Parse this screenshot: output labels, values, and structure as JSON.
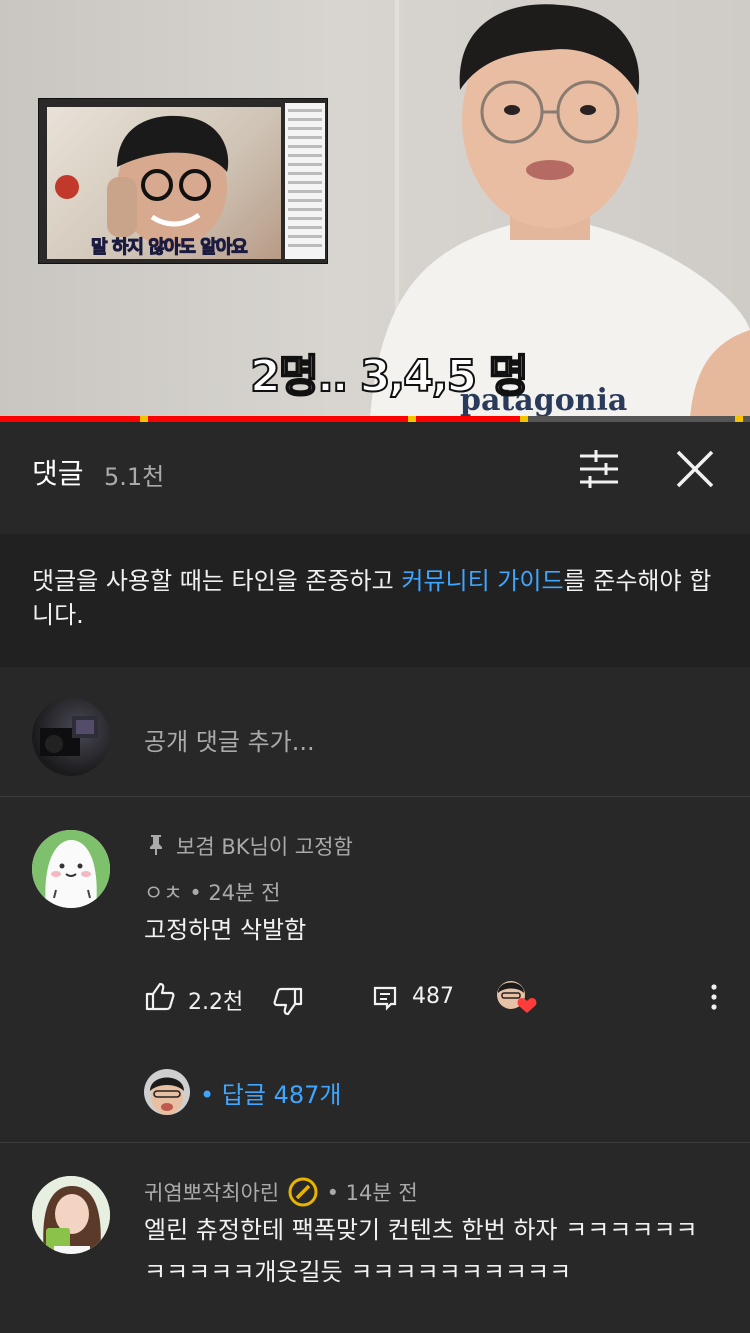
{
  "video": {
    "inset_caption_highlight": "말 하지",
    "inset_caption_rest": " 않아도 알아요",
    "caption": "2명.. 3,4,5 명",
    "shirt_text": "patagonia",
    "progress_fraction": 0.7
  },
  "comments_panel": {
    "title": "댓글",
    "count": "5.1천",
    "guideline_before": "댓글을 사용할 때는 타인을 존중하고 ",
    "guideline_link": "커뮤니티 가이드",
    "guideline_after": "를 준수해야 합니다.",
    "add_comment_placeholder": "공개 댓글 추가..."
  },
  "comments": [
    {
      "pinned_label": "보겸 BK님이 고정함",
      "author": "ㅇㅊ",
      "time": "• 24분 전",
      "text": "고정하면 삭발함",
      "likes": "2.2천",
      "reply_count": "487",
      "replies_link": "• 답글 487개"
    },
    {
      "author": "귀염뽀작최아린",
      "time": "• 14분 전",
      "text": "엘린 츄정한테 팩폭맞기 컨텐츠 한번 하자 ㅋㅋㅋㅋㅋㅋㅋㅋㅋㅋㅋ개웃길듯 ㅋㅋㅋㅋㅋㅋㅋㅋㅋㅋ"
    }
  ],
  "colors": {
    "background": "#282828",
    "guide_background": "#212121",
    "link": "#3ea6ff",
    "progress": "#ff0000",
    "heart": "#ff3b3b",
    "secondary_text": "#aaaaaa"
  }
}
